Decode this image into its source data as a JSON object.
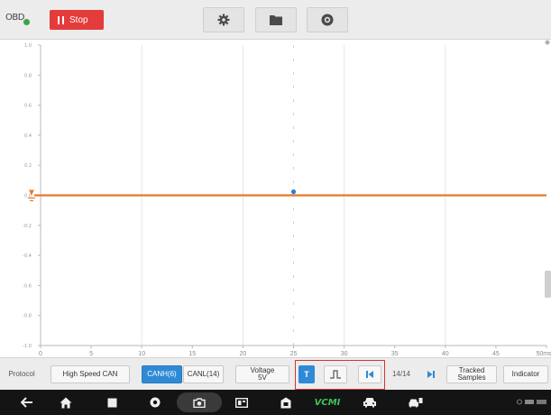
{
  "toolbar": {
    "obd_label": "OBD",
    "stop_label": "Stop",
    "colors": {
      "stop": "#e43b3b",
      "obd_status": "#3aa54a"
    },
    "icons": [
      "gear-icon",
      "folder-icon",
      "help-icon"
    ]
  },
  "chart_data": {
    "type": "line",
    "title": "",
    "xlabel": "",
    "ylabel": "",
    "x_unit": "ms",
    "xlim": [
      0,
      50
    ],
    "x_ticks": [
      "0",
      "5",
      "10",
      "15",
      "20",
      "25",
      "30",
      "35",
      "40",
      "45",
      "50"
    ],
    "x_tick_values": [
      0,
      5,
      10,
      15,
      20,
      25,
      30,
      35,
      40,
      45,
      50
    ],
    "y_tick_labels": [
      "1.0",
      "0.8",
      "0.6",
      "0.4",
      "0.2",
      "0.0",
      "-0.2",
      "-0.4",
      "-0.6",
      "-0.8",
      "-1.0"
    ],
    "ylim": [
      -1.0,
      1.0
    ],
    "grid": true,
    "series": [
      {
        "color": "#e8782a",
        "x": [
          0,
          50
        ],
        "y": [
          0,
          0
        ]
      }
    ],
    "trigger_marker": {
      "x": 25,
      "y": 0,
      "color": "#2f7fd6"
    }
  },
  "controls": {
    "protocol_label": "Protocol",
    "protocol_value": "High Speed CAN",
    "can_h": "CANH(6)",
    "can_l": "CANL(14)",
    "voltage_line1": "Voltage",
    "voltage_line2": "5V",
    "trigger_t": "T",
    "page": "14/14",
    "trace_line1": "Tracked",
    "trace_line2": "Samples",
    "indicator": "Indicator",
    "colors": {
      "selected": "#2f8ad6",
      "highlight_box": "#d43535"
    }
  },
  "navbar": {
    "icons": [
      "back-icon",
      "home-icon",
      "recent-apps-icon",
      "browser-icon",
      "camera-icon",
      "screen-record-icon",
      "vci-icon",
      "vcm-icon",
      "car-icon",
      "car-service-icon"
    ],
    "vcm_label": "VCMI"
  }
}
